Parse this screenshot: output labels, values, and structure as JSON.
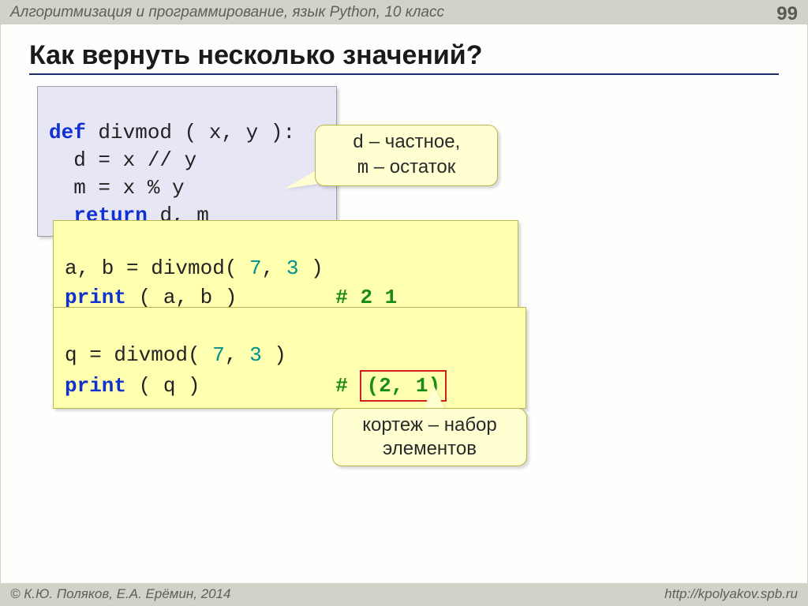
{
  "header": {
    "subject": "Алгоритмизация и программирование, язык Python, 10 класс",
    "page_number": "99"
  },
  "slide": {
    "title": "Как вернуть несколько значений?"
  },
  "code": {
    "box1": {
      "l1a": "def",
      "l1b": " divmod ( x, y ):",
      "l2": "  d = x // y",
      "l3": "  m = x % y",
      "l4a": "  ",
      "l4b": "return",
      "l4c": " d, m"
    },
    "box2": {
      "l1a": "a, b = divmod( ",
      "l1b": "7",
      "l1c": ", ",
      "l1d": "3",
      "l1e": " )",
      "l2a": "print",
      "l2b": " ( a, b )        ",
      "l2c": "# 2 1"
    },
    "box3": {
      "l1a": "q = divmod( ",
      "l1b": "7",
      "l1c": ", ",
      "l1d": "3",
      "l1e": " )",
      "l2a": "print",
      "l2b": " ( q )           ",
      "l2c": "#",
      "l2d": " ",
      "l2e": "(2, 1)"
    }
  },
  "callouts": {
    "c1_l1a": "d",
    "c1_l1b": " – частное,",
    "c1_l2a": "m",
    "c1_l2b": " – остаток",
    "c2_l1": "кортеж – набор",
    "c2_l2": "элементов"
  },
  "footer": {
    "copyright": "© К.Ю. Поляков, Е.А. Ерёмин, 2014",
    "url": "http://kpolyakov.spb.ru"
  }
}
